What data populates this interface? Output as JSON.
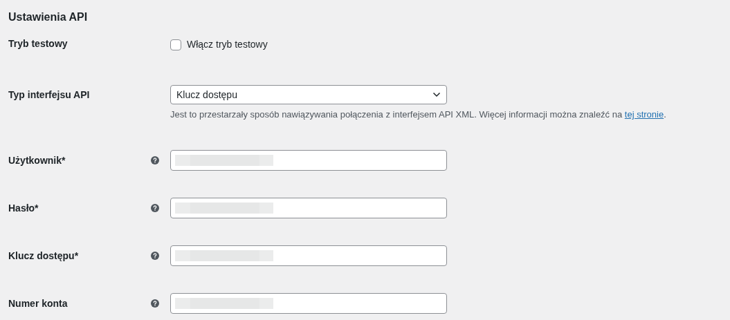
{
  "heading": "Ustawienia API",
  "rows": [
    {
      "kind": "checkbox",
      "label": "Tryb testowy",
      "help": false,
      "checked": false,
      "option": "Włącz tryb testowy"
    },
    {
      "kind": "select",
      "label": "Typ interfejsu API",
      "help": false,
      "value": "Klucz dostępu",
      "description": {
        "text": "Jest to przestarzały sposób nawiązywania połączenia z interfejsem API XML. Więcej informacji można znaleźć na ",
        "link": "tej stronie",
        "after": "."
      }
    },
    {
      "kind": "text",
      "label": "Użytkownik*",
      "help": true
    },
    {
      "kind": "text",
      "label": "Hasło*",
      "help": true
    },
    {
      "kind": "text",
      "label": "Klucz dostępu*",
      "help": true
    },
    {
      "kind": "text",
      "label": "Numer konta",
      "help": true
    }
  ]
}
